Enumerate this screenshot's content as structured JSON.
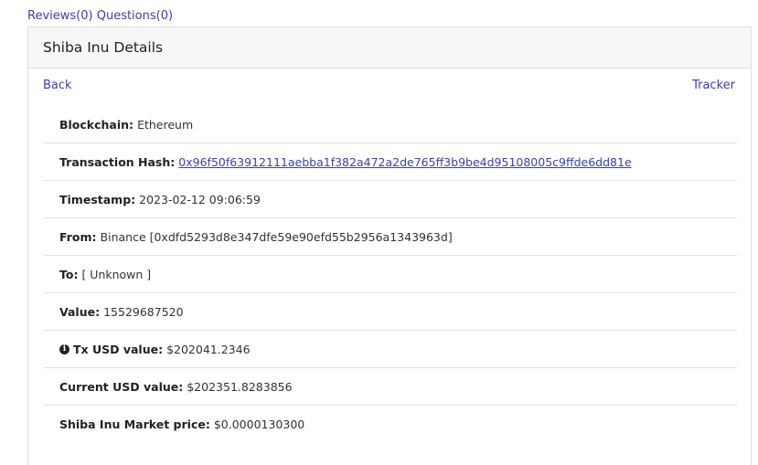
{
  "top_links": {
    "reviews": "Reviews(0)",
    "questions": "Questions(0)"
  },
  "card": {
    "title": "Shiba Inu Details",
    "back_label": "Back",
    "tracker_label": "Tracker"
  },
  "details": [
    {
      "label": "Blockchain:",
      "value": "Ethereum"
    },
    {
      "label": "Transaction Hash:",
      "value": "0x96f50f63912111aebba1f382a472a2de765ff3b9be4d95108005c9ffde6dd81e"
    },
    {
      "label": "Timestamp:",
      "value": "2023-02-12 09:06:59"
    },
    {
      "label": "From:",
      "value": "Binance [0xdfd5293d8e347dfe59e90efd55b2956a1343963d]"
    },
    {
      "label": "To:",
      "value": "[ Unknown ]"
    },
    {
      "label": "Value:",
      "value": "15529687520"
    },
    {
      "label": "Tx USD value:",
      "value": "$202041.2346",
      "icon": "info-icon"
    },
    {
      "label": "Current USD value:",
      "value": "$202351.8283856"
    },
    {
      "label": "Shiba Inu Market price:",
      "value": "$0.0000130300"
    }
  ],
  "colors": {
    "link": "#3c3fb0",
    "header_bg": "#f7f7f7",
    "border": "#dfdfdf"
  }
}
